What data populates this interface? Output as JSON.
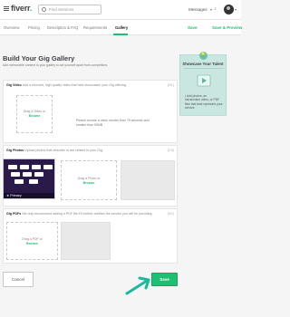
{
  "nav": {
    "logo": "fiverr",
    "logo_dot": ".",
    "search_placeholder": "Find Services",
    "messages": "Messages",
    "caret": "▾"
  },
  "tabs": [
    {
      "label": "Overview"
    },
    {
      "label": "Pricing"
    },
    {
      "label": "Description & FAQ"
    },
    {
      "label": "Requirements"
    },
    {
      "label": "Gallery"
    }
  ],
  "tab_actions": {
    "save": "Save",
    "save_preview": "Save & Preview"
  },
  "page": {
    "title": "Build Your Gig Gallery",
    "subtitle": "Add memorable content to your gallery to set yourself apart from competitors."
  },
  "sections": {
    "video": {
      "title": "Gig Video",
      "desc": "Add a relevant, high quality video that best showcases your Gig offering.",
      "count": "(0/1)",
      "drop_line1": "Drag a Video or",
      "drop_line2": "Browse",
      "note": "Please choose a video shorter than 75 seconds and smaller than 50MB"
    },
    "photos": {
      "title": "Gig Photos",
      "desc": "Upload photos that describe or are related to your Gig.",
      "count": "(1/3)",
      "primary_label": "Primary",
      "drop_line1": "Drag a Photo or",
      "drop_line2": "Browse"
    },
    "pdfs": {
      "title": "Gig PDFs",
      "desc": "We only recommend adding a PDF file if it further clarifies the service you will be providing.",
      "count": "(0/2)",
      "drop_line1": "Drag a PDF or",
      "drop_line2": "Browse"
    }
  },
  "showcase": {
    "bubble": "💡",
    "title": "Showcase Your Talent",
    "bullet": "• Add photos, an introduction video, or PDF files that best represent your service."
  },
  "footer": {
    "cancel": "Cancel",
    "save": "Save"
  },
  "colors": {
    "brand": "#1dbf73",
    "arrow": "#1db99a",
    "showcase_bg": "#c9e7e0"
  }
}
